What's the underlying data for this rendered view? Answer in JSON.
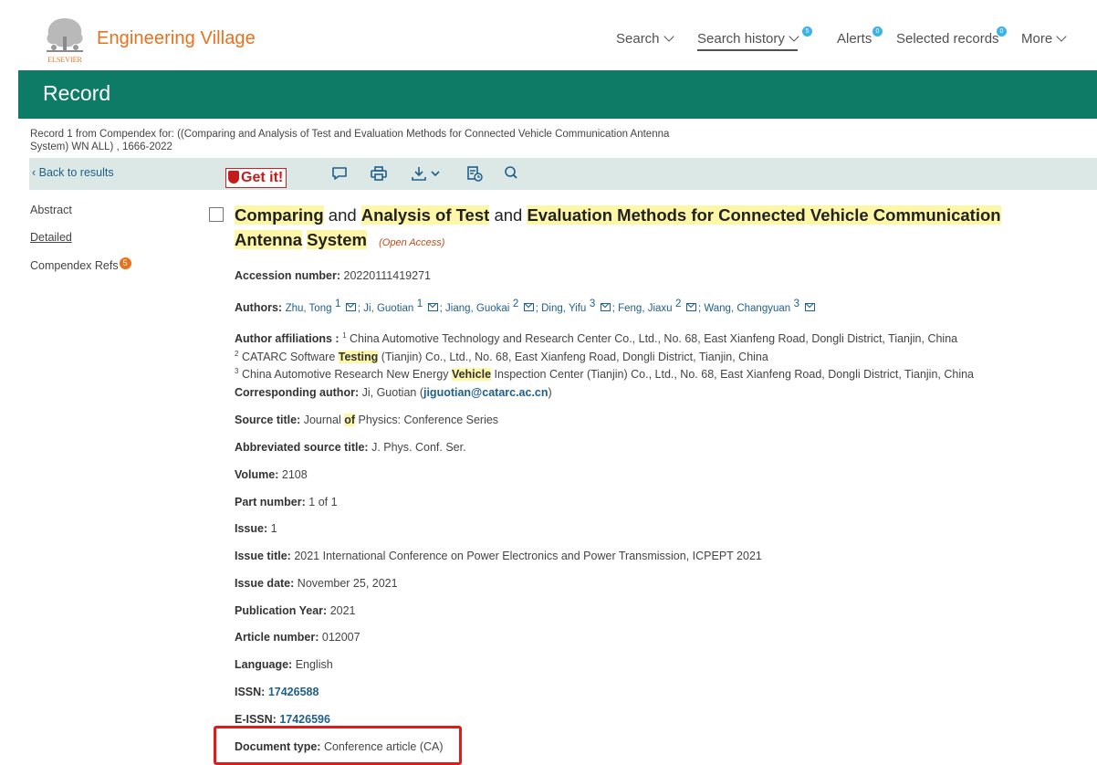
{
  "brand": {
    "name": "Engineering Village",
    "publisher": "ELSEVIER"
  },
  "nav": {
    "search": "Search",
    "search_history": "Search history",
    "search_history_badge": "5",
    "alerts": "Alerts",
    "alerts_badge": "0",
    "selected_records": "Selected records",
    "selected_badge": "0",
    "more": "More"
  },
  "page_title": "Record",
  "query": {
    "line1": "Record 1 from Compendex for: ((Comparing and Analysis of Test and Evaluation Methods for Connected Vehicle Communication Antenna",
    "line2": "System) WN ALL) , 1666-2022"
  },
  "toolbar": {
    "back": "Back to results",
    "getit": "Get it!"
  },
  "sidebar": {
    "abstract": "Abstract",
    "detailed": "Detailed",
    "refs": "Compendex Refs",
    "refs_count": "5"
  },
  "record": {
    "title_parts": [
      "Comparing",
      "and",
      "Analysis of Test",
      "and",
      "Evaluation Methods for Connected Vehicle Communication Antenna",
      "System"
    ],
    "open_access": "(Open Access)",
    "accession_label": "Accession number:",
    "accession": "20220111419271",
    "authors_label": "Authors:",
    "authors": [
      {
        "name": "Zhu, Tong",
        "aff": "1"
      },
      {
        "name": "Ji, Guotian",
        "aff": "1"
      },
      {
        "name": "Jiang, Guokai",
        "aff": "2"
      },
      {
        "name": "Ding, Yifu",
        "aff": "3"
      },
      {
        "name": "Feng, Jiaxu",
        "aff": "2"
      },
      {
        "name": "Wang, Changyuan",
        "aff": "3"
      }
    ],
    "affil_label": "Author affiliations :",
    "affil1_num": "1",
    "affil1": "China Automotive Technology and Research Center Co., Ltd., No. 68, East Xianfeng Road, Dongli District, Tianjin, China",
    "affil2_num": "2",
    "affil2_a": "CATARC Software",
    "affil2_hl": "Testing",
    "affil2_b": "(Tianjin) Co., Ltd., No. 68, East Xianfeng Road, Dongli District, Tianjin, China",
    "affil3_num": "3",
    "affil3_a": "China Automotive Research New Energy",
    "affil3_hl": "Vehicle",
    "affil3_b": "Inspection Center (Tianjin) Co., Ltd., No. 68, East Xianfeng Road, Dongli District, Tianjin, China",
    "corr_label": "Corresponding author:",
    "corr_name": "Ji, Guotian (",
    "corr_email": "jiguotian@catarc.ac.cn",
    "corr_close": ")",
    "source_label": "Source title:",
    "source_a": "Journal",
    "source_hl": "of",
    "source_b": "Physics: Conference Series",
    "abbr_label": "Abbreviated source title:",
    "abbr": "J. Phys. Conf. Ser.",
    "volume_label": "Volume:",
    "volume": "2108",
    "part_label": "Part number:",
    "part": "1 of 1",
    "issue_label": "Issue:",
    "issue": "1",
    "issue_title_label": "Issue title:",
    "issue_title": "2021 International Conference on Power Electronics and Power Transmission, ICPEPT 2021",
    "issue_date_label": "Issue date:",
    "issue_date": "November 25, 2021",
    "pubyear_label": "Publication Year:",
    "pubyear": "2021",
    "article_label": "Article number:",
    "article": "012007",
    "lang_label": "Language:",
    "lang": "English",
    "issn_label": "ISSN:",
    "issn": "17426588",
    "eissn_label": "E-ISSN:",
    "eissn": "17426596",
    "doctype_label": "Document type:",
    "doctype": "Conference article (CA)"
  },
  "colors": {
    "brand_orange": "#e9711c",
    "header_green": "#0e7b67",
    "toolbar_bg": "#dbe8e6",
    "link_blue": "#1f5f8b",
    "highlight": "#fff7a8",
    "annotation_red": "#e11b1b"
  }
}
